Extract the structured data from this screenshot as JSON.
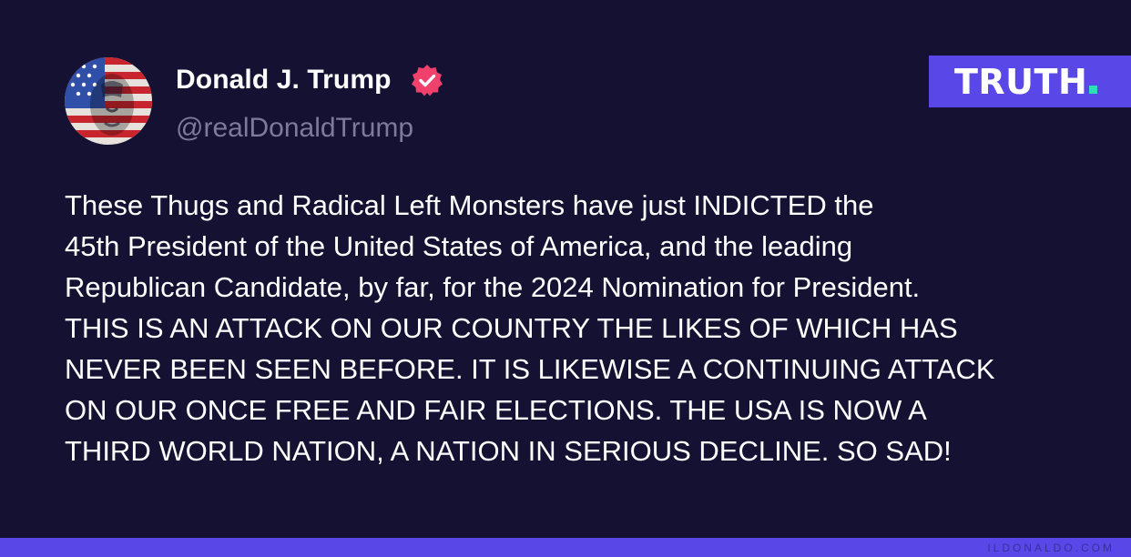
{
  "author": {
    "display_name": "Donald J. Trump",
    "handle": "@realDonaldTrump",
    "verified_icon": "verified-badge-icon",
    "avatar_icon": "flag-painted-face-avatar"
  },
  "brand": {
    "logo_text": "TRUTH",
    "accent_color": "#5a47e8",
    "dot_color": "#2de0b3"
  },
  "post": {
    "lines": [
      "These Thugs and Radical Left Monsters have just INDICTED the",
      "45th President of the United States of America, and the leading",
      "Republican Candidate, by far, for the 2024 Nomination for President.",
      "THIS IS AN ATTACK ON OUR COUNTRY THE LIKES OF WHICH HAS",
      "NEVER BEEN SEEN BEFORE. IT IS LIKEWISE A CONTINUING ATTACK",
      "ON OUR ONCE FREE AND FAIR ELECTIONS. THE USA IS NOW A",
      "THIRD WORLD NATION, A NATION IN SERIOUS DECLINE. SO SAD!"
    ]
  },
  "footer": {
    "watermark": "ILDONALDO.COM"
  },
  "colors": {
    "background": "#151133",
    "handle": "#7d7a9a",
    "verified": "#f0416c"
  }
}
